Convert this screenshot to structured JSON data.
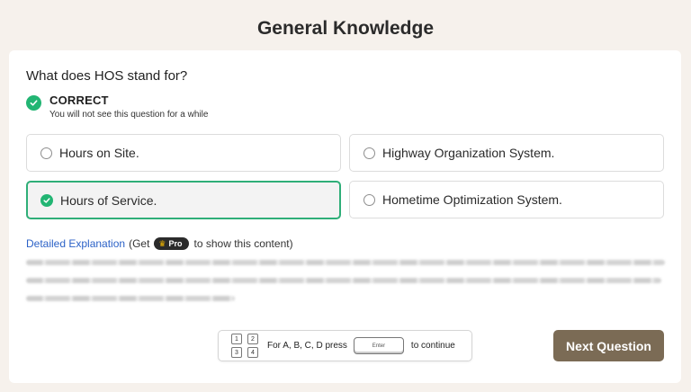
{
  "header": {
    "title": "General Knowledge"
  },
  "question": {
    "text": "What does HOS stand for?",
    "result_title": "CORRECT",
    "result_subtitle": "You will not see this question for a while"
  },
  "options": [
    {
      "label": "Hours on Site.",
      "selected": false
    },
    {
      "label": "Highway Organization System.",
      "selected": false
    },
    {
      "label": "Hours of Service.",
      "selected": true
    },
    {
      "label": "Hometime Optimization System.",
      "selected": false
    }
  ],
  "explanation": {
    "link_label": "Detailed Explanation",
    "prefix": "(Get",
    "badge": "Pro",
    "suffix": "to show this content)"
  },
  "keyboard_hint": {
    "keys": [
      "1",
      "2",
      "3",
      "4"
    ],
    "text_before": "For A, B, C, D  press",
    "enter_label": "Enter",
    "text_after": "to continue"
  },
  "actions": {
    "next_label": "Next Question"
  },
  "colors": {
    "accent_green": "#22b573",
    "button_brown": "#7b6b55",
    "link_blue": "#2c62c7"
  },
  "icons": {
    "result": "check-circle-icon",
    "badge": "crown-icon"
  }
}
